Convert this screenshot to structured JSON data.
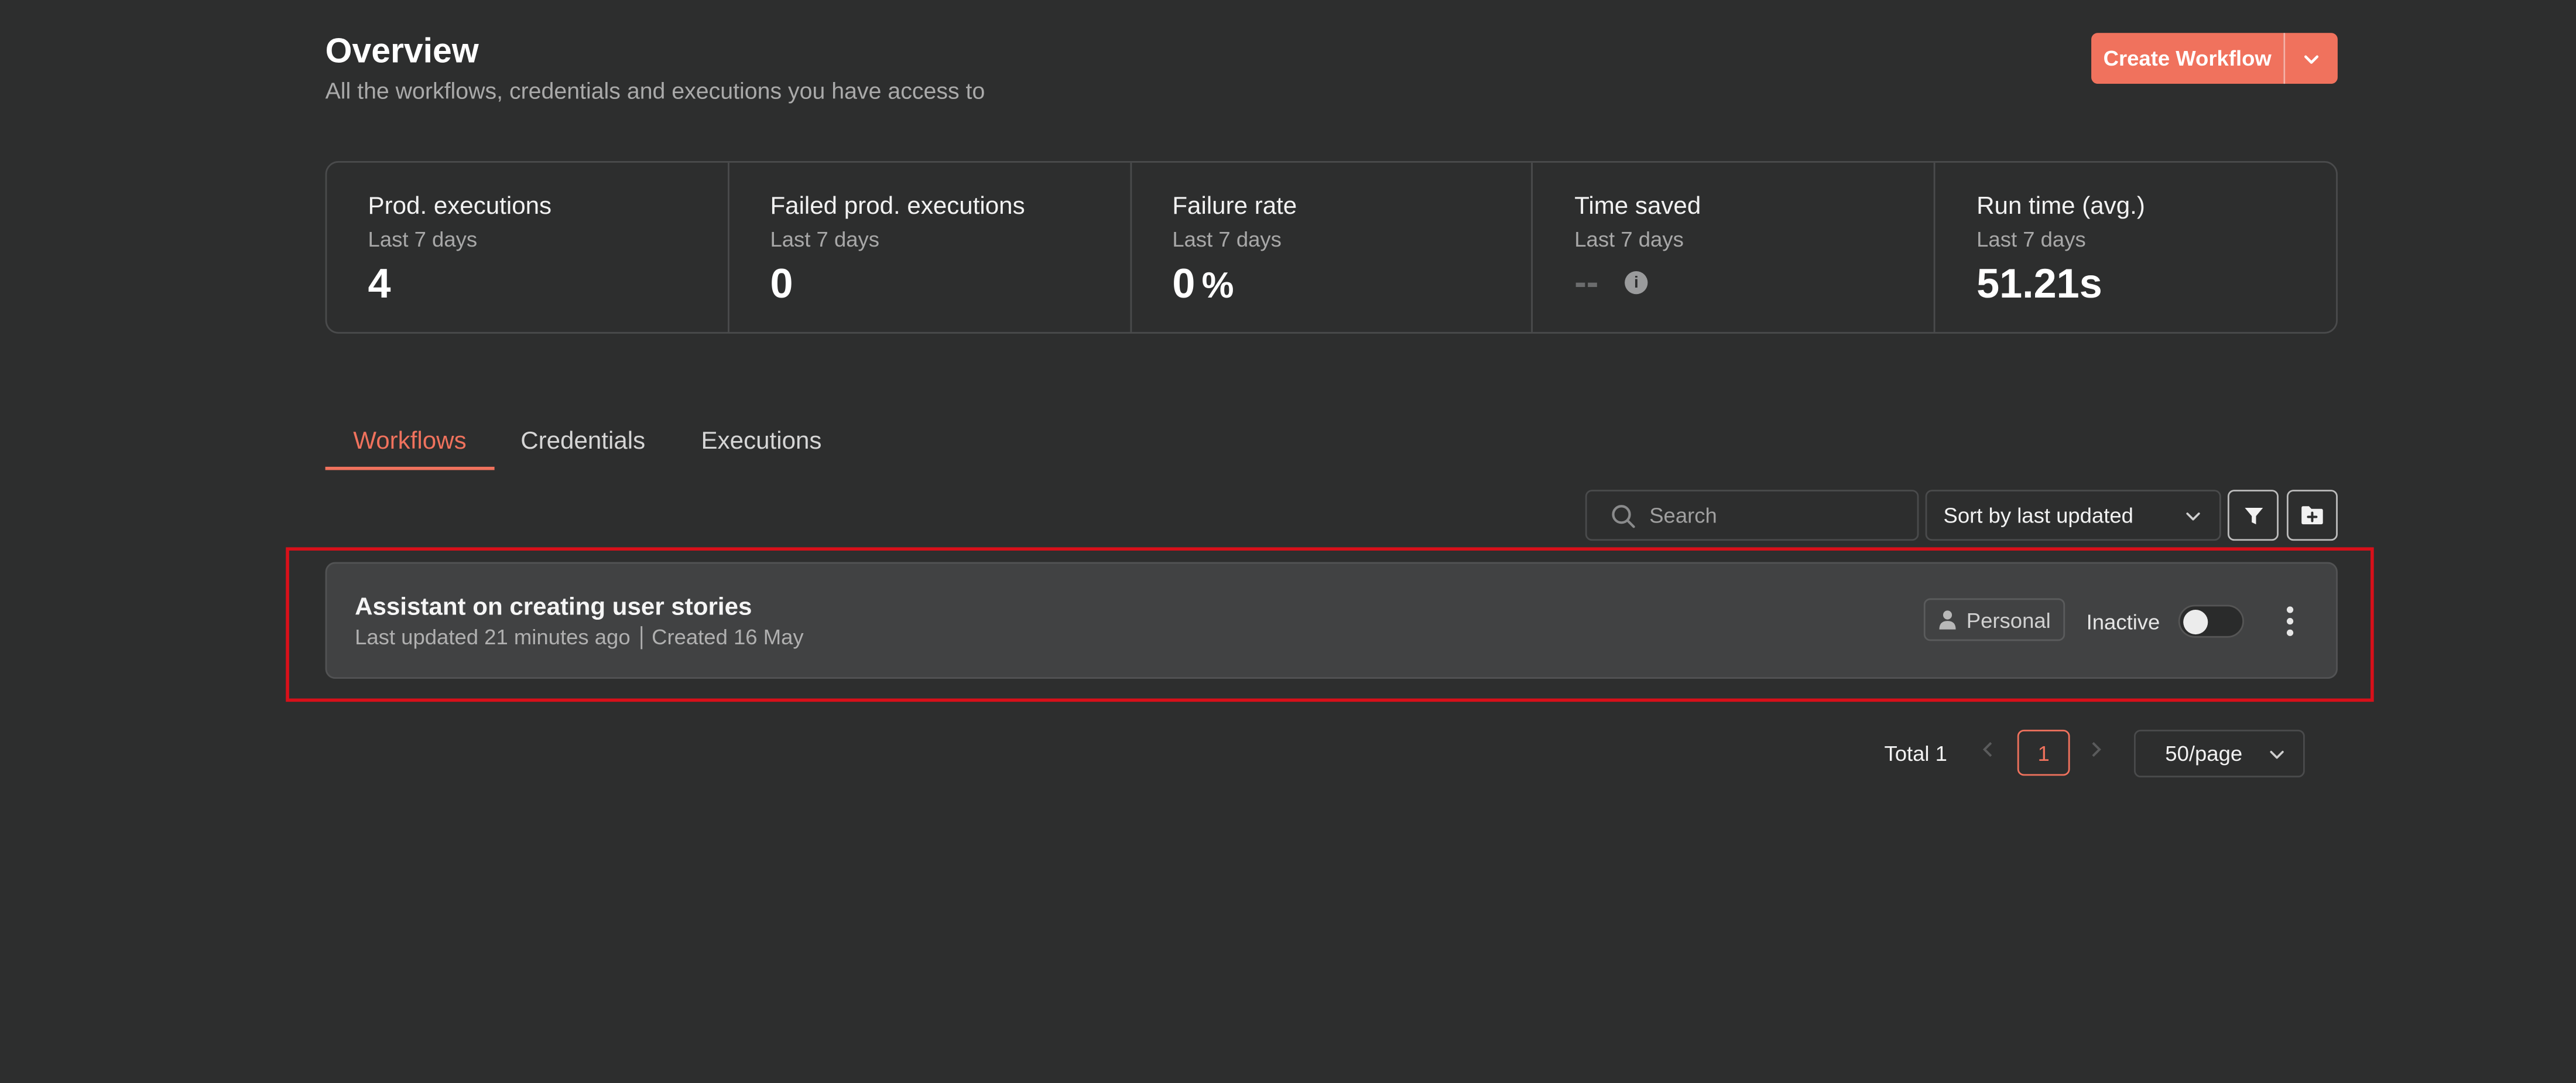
{
  "header": {
    "title": "Overview",
    "subtitle": "All the workflows, credentials and executions you have access to",
    "create_button_label": "Create Workflow"
  },
  "stats": [
    {
      "label": "Prod. executions",
      "period": "Last 7 days",
      "value": "4",
      "unit": ""
    },
    {
      "label": "Failed prod. executions",
      "period": "Last 7 days",
      "value": "0",
      "unit": ""
    },
    {
      "label": "Failure rate",
      "period": "Last 7 days",
      "value": "0",
      "unit": "%"
    },
    {
      "label": "Time saved",
      "period": "Last 7 days",
      "value": "--",
      "unit": ""
    },
    {
      "label": "Run time (avg.)",
      "period": "Last 7 days",
      "value": "51.21s",
      "unit": ""
    }
  ],
  "tabs": [
    {
      "label": "Workflows",
      "active": true
    },
    {
      "label": "Credentials",
      "active": false
    },
    {
      "label": "Executions",
      "active": false
    }
  ],
  "toolbar": {
    "search_placeholder": "Search",
    "sort_value": "Sort by last updated"
  },
  "workflow": {
    "name": "Assistant on creating user stories",
    "last_updated": "Last updated 21 minutes ago",
    "created": "Created 16 May",
    "owner_badge": "Personal",
    "status": "Inactive"
  },
  "pagination": {
    "total_label": "Total 1",
    "current_page": "1",
    "page_size": "50/page"
  },
  "colors": {
    "accent": "#f0725d",
    "background": "#2d2e2e",
    "highlight_border": "#d8101a"
  }
}
